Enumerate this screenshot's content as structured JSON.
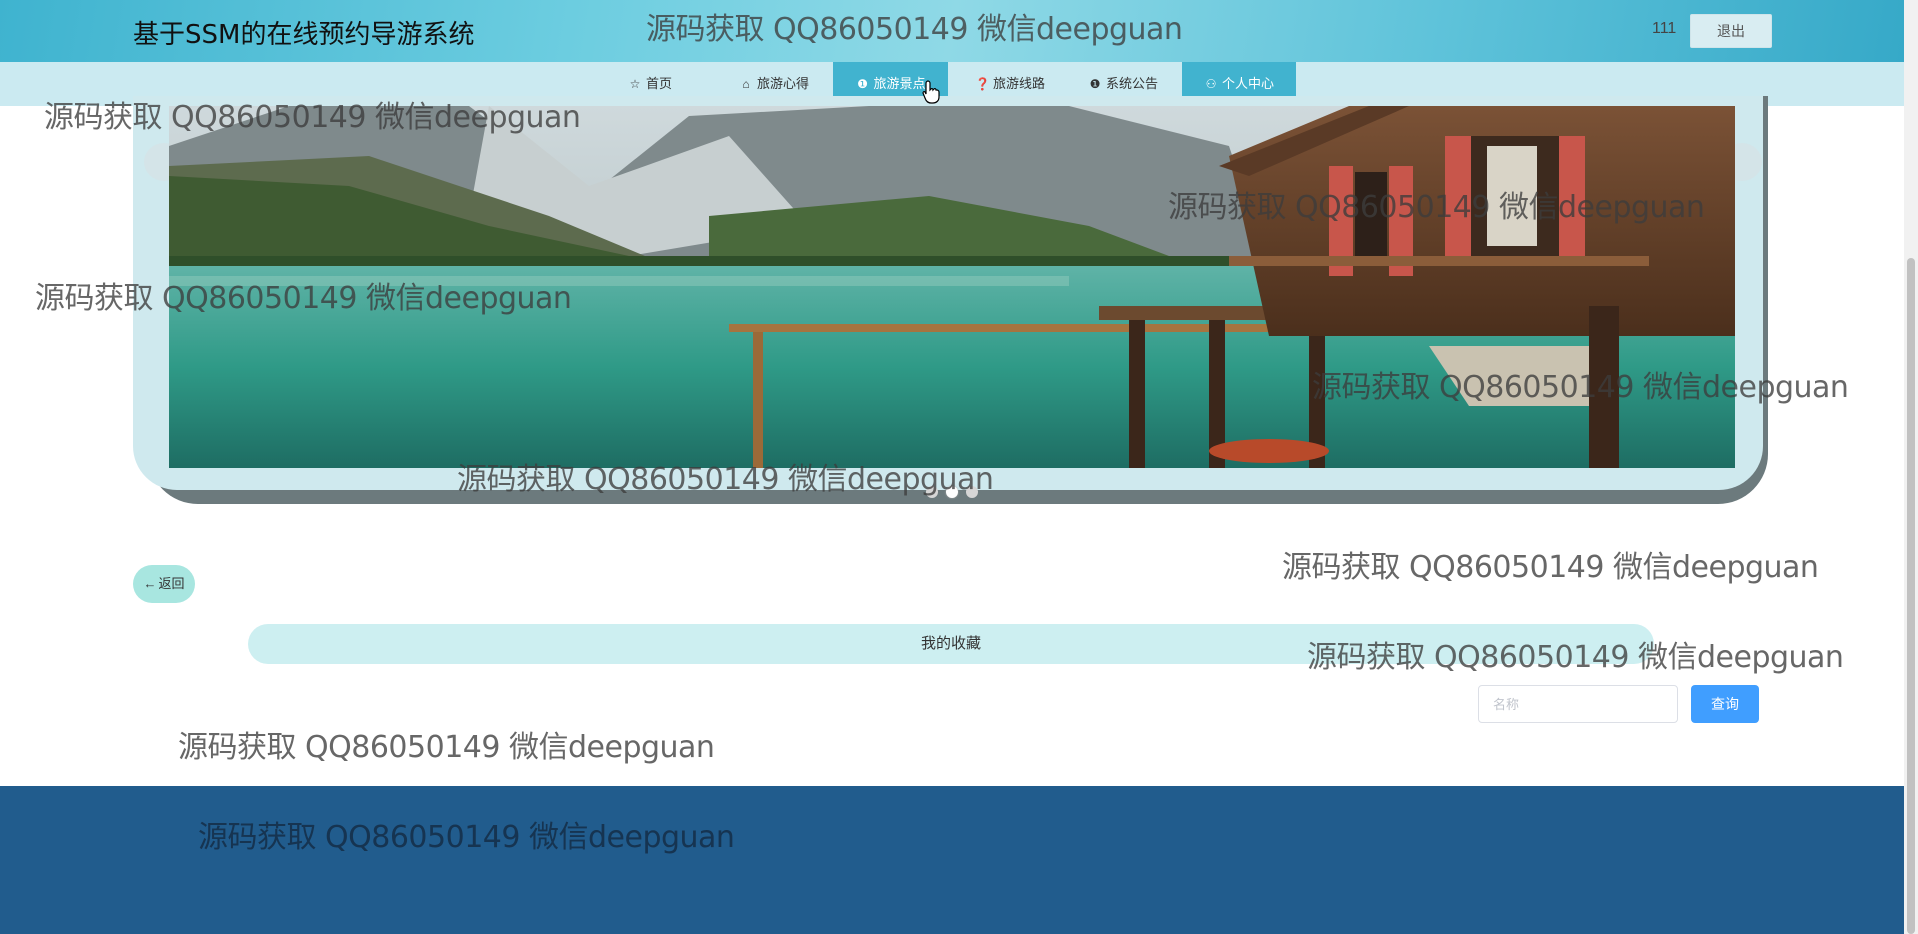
{
  "header": {
    "title": "基于SSM的在线预约导游系统",
    "user": "111",
    "logout_label": "退出"
  },
  "nav": {
    "items": [
      {
        "label": "首页",
        "icon": "star-icon"
      },
      {
        "label": "旅游心得",
        "icon": "bag-icon"
      },
      {
        "label": "旅游景点",
        "icon": "info-icon",
        "active": true
      },
      {
        "label": "旅游线路",
        "icon": "question-icon"
      },
      {
        "label": "系统公告",
        "icon": "info-icon"
      },
      {
        "label": "个人中心",
        "icon": "user-icon"
      }
    ]
  },
  "carousel": {
    "slide_count": 3,
    "active_index": 1
  },
  "back_label": "返回",
  "section_title": "我的收藏",
  "search": {
    "placeholder": "名称",
    "value": "",
    "button_label": "查询"
  },
  "watermark": "源码获取 QQ86050149 微信deepguan",
  "colors": {
    "header_gradient": "#5fc3da",
    "nav_bg": "#cbeaf1",
    "nav_active": "#41b3cf",
    "search_button": "#409eff",
    "footer": "#215c8d",
    "section_bar": "#cdeff1"
  }
}
